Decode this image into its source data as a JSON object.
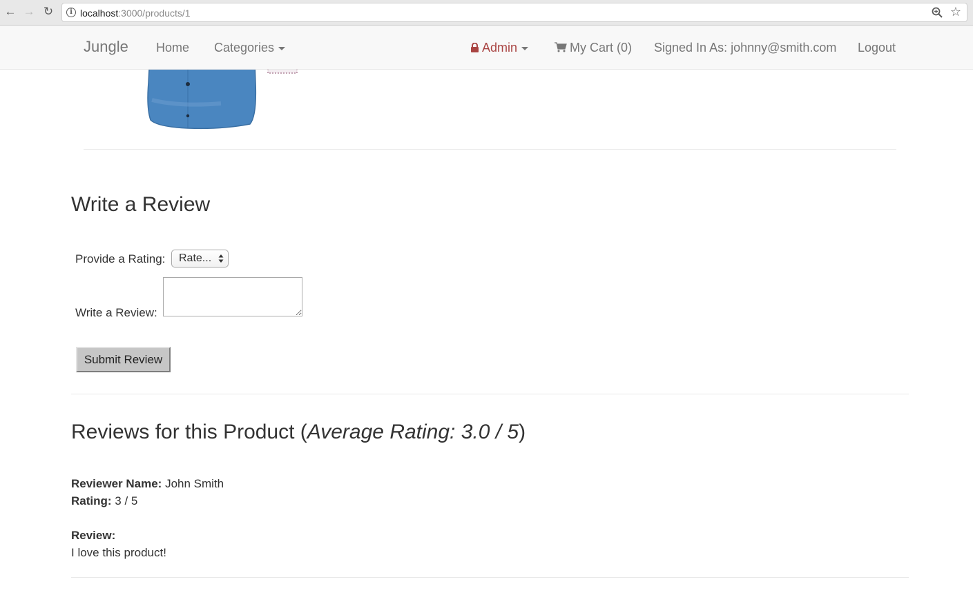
{
  "browser": {
    "url_host": "localhost",
    "url_path": ":3000/products/1"
  },
  "navbar": {
    "brand": "Jungle",
    "home": "Home",
    "categories": "Categories",
    "admin": "Admin",
    "cart": "My Cart (0)",
    "signed_in": "Signed In As: johnny@smith.com",
    "logout": "Logout"
  },
  "review_form": {
    "title": "Write a Review",
    "rating_label": "Provide a Rating:",
    "rating_selected": "Rate...",
    "review_label": "Write a Review:",
    "review_value": "",
    "submit_label": "Submit Review"
  },
  "reviews": {
    "title_prefix": "Reviews for this Product (",
    "average_text": "Average Rating: 3.0 / 5",
    "title_suffix": ")",
    "items": [
      {
        "name_label": "Reviewer Name:",
        "name": "John Smith",
        "rating_label": "Rating:",
        "rating": "3 / 5",
        "review_label": "Review:",
        "review": "I love this product!"
      }
    ]
  },
  "colors": {
    "navbar_bg": "#f8f8f8",
    "admin_red": "#a94442",
    "shirt_blue": "#4a86c0"
  }
}
